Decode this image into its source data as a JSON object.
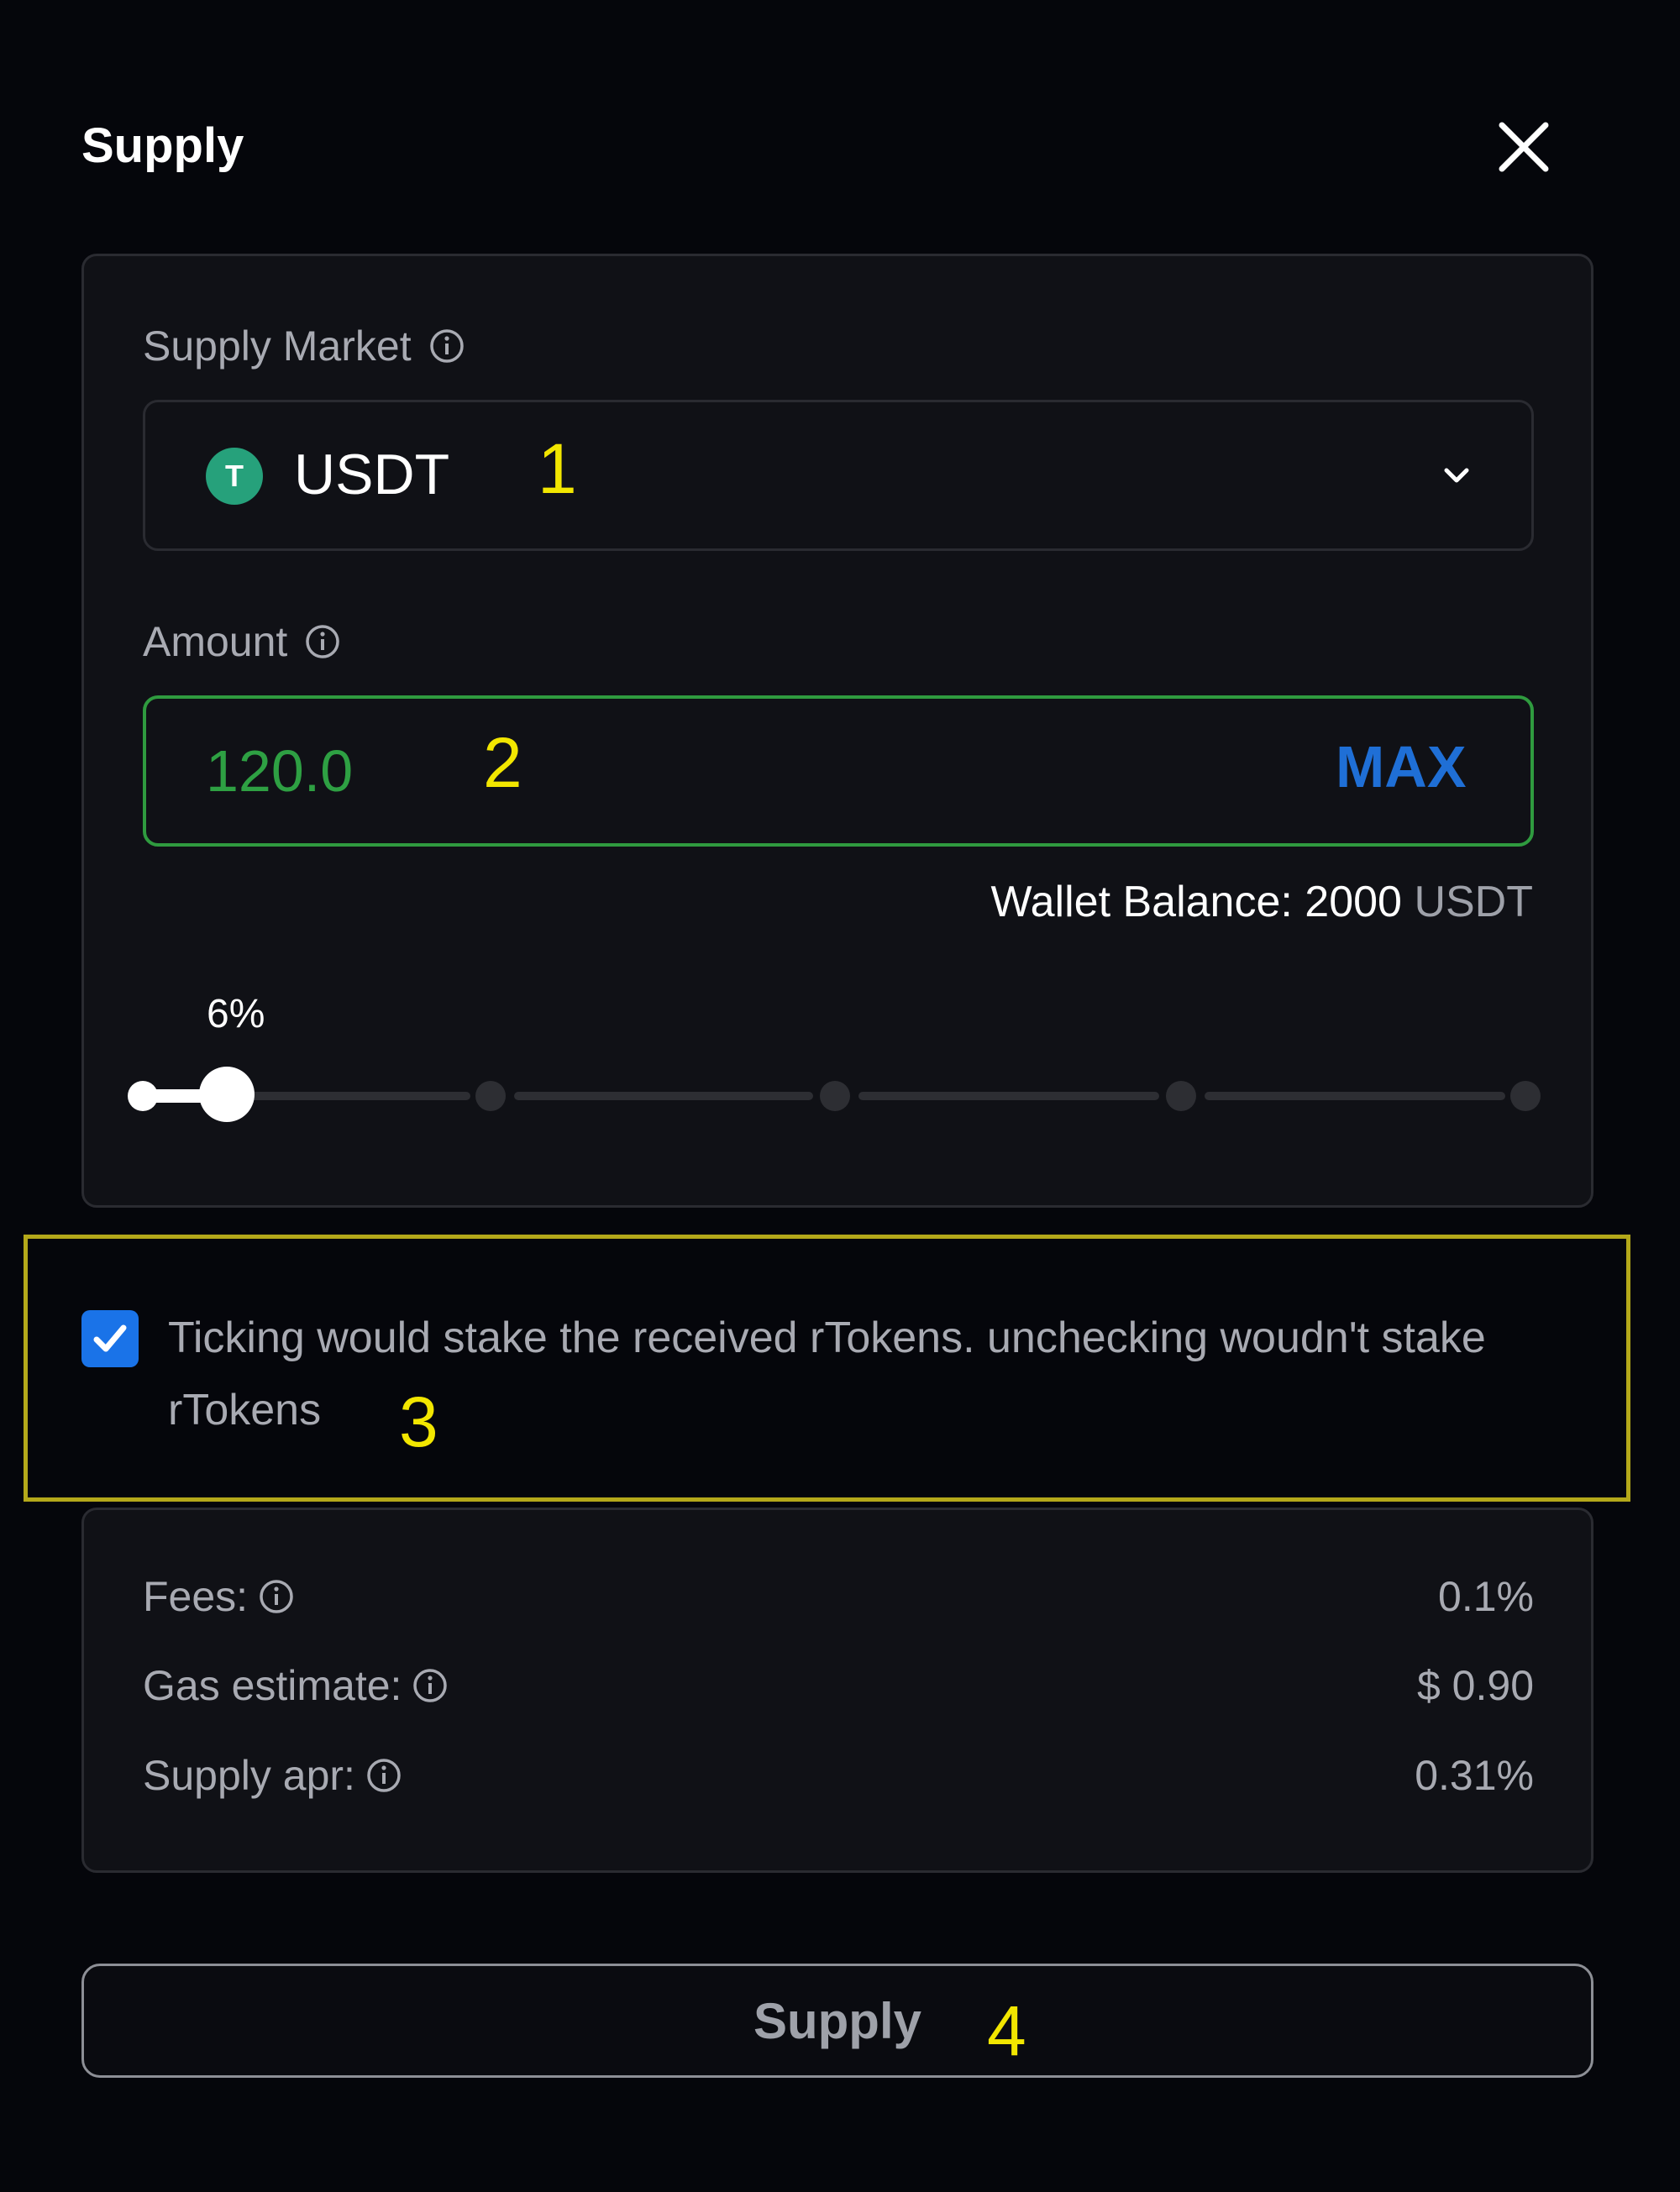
{
  "dialog": {
    "title": "Supply",
    "close_icon": "close-icon"
  },
  "market": {
    "label": "Supply Market",
    "selected_token": "USDT",
    "token_icon_color": "#26a17b",
    "token_icon_glyph": "T"
  },
  "amount": {
    "label": "Amount",
    "value": "120.0",
    "max_label": "MAX",
    "balance_label": "Wallet Balance:",
    "balance_value": "2000",
    "balance_unit": "USDT"
  },
  "slider": {
    "percent_label": "6%",
    "percent_value": 6,
    "steps": [
      0,
      25,
      50,
      75,
      100
    ]
  },
  "stake": {
    "checked": true,
    "text": "Ticking would stake the received rTokens. unchecking woudn't stake rTokens"
  },
  "fees": [
    {
      "label": "Fees:",
      "value": "0.1%"
    },
    {
      "label": "Gas estimate:",
      "value": "$ 0.90"
    },
    {
      "label": "Supply apr:",
      "value": "0.31%"
    }
  ],
  "submit": {
    "label": "Supply"
  },
  "annotations": [
    "1",
    "2",
    "3",
    "4"
  ],
  "colors": {
    "accent_blue": "#1a73e8",
    "success_green": "#2ea043",
    "highlight_yellow": "#b4a81a",
    "annotation_yellow": "#f2e600"
  }
}
